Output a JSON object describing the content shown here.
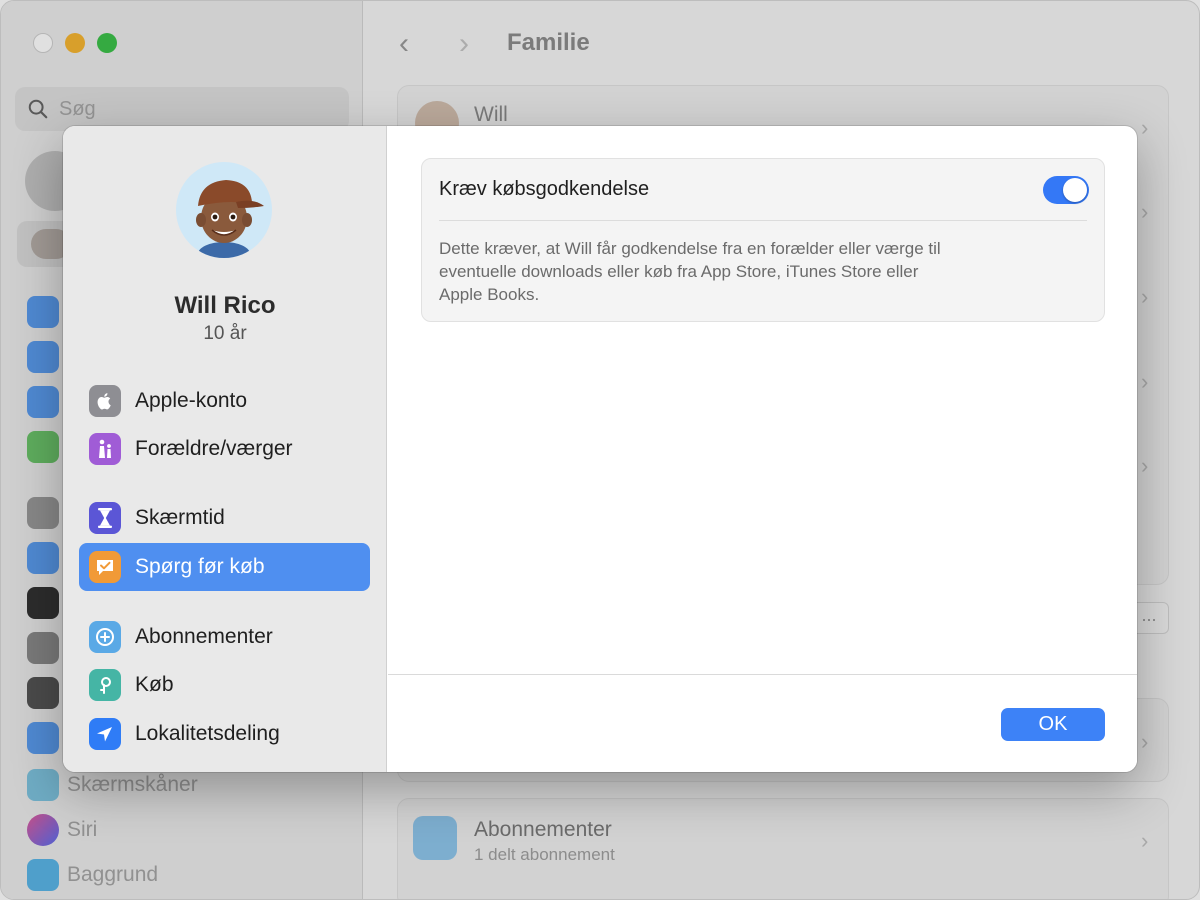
{
  "background": {
    "search_placeholder": "Søg",
    "window_title": "Familie",
    "member_name": "Will",
    "sidebar_items": [
      "Skærmskåner",
      "Siri",
      "Baggrund"
    ],
    "subscriptions_title": "Abonnementer",
    "subscriptions_subtitle": "1 delt abonnement",
    "more_label": "..."
  },
  "sheet": {
    "user": {
      "name": "Will Rico",
      "age": "10 år"
    },
    "nav": [
      {
        "label": "Apple-konto",
        "icon": "apple-icon",
        "color": "#8e8e93",
        "selected": false
      },
      {
        "label": "Forældre/værger",
        "icon": "parents-icon",
        "color": "#a05cd6",
        "selected": false
      },
      {
        "label": "Skærmtid",
        "icon": "hourglass-icon",
        "color": "#5b56d6",
        "selected": false
      },
      {
        "label": "Spørg før køb",
        "icon": "ask-to-buy-icon",
        "color": "#f19a37",
        "selected": true
      },
      {
        "label": "Abonnementer",
        "icon": "subscriptions-icon",
        "color": "#5aa9e6",
        "selected": false
      },
      {
        "label": "Køb",
        "icon": "purchases-icon",
        "color": "#45b5a5",
        "selected": false
      },
      {
        "label": "Lokalitetsdeling",
        "icon": "location-icon",
        "color": "#2f7cf6",
        "selected": false
      }
    ],
    "setting": {
      "title": "Kræv købsgodkendelse",
      "toggle_on": true,
      "description_lines": [
        "Dette kræver, at Will får godkendelse fra en forælder eller værge til",
        "eventuelle downloads eller køb fra App Store, iTunes Store eller",
        "Apple Books."
      ]
    },
    "ok_label": "OK"
  },
  "colors": {
    "accent": "#3478f6",
    "selected_row": "#4f8ff0"
  }
}
